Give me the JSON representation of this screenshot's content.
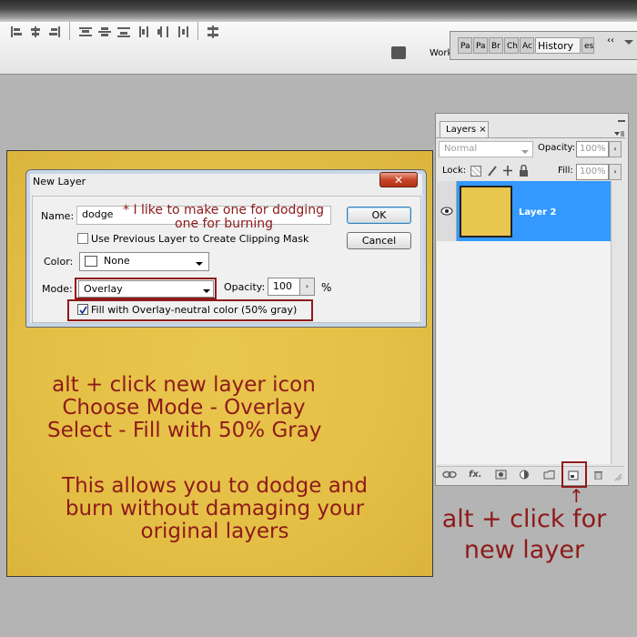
{
  "toolbar": {
    "workspace_label": "Work",
    "panel_tabs": [
      "Pa",
      "Pa",
      "Br",
      "Ch",
      "Ac",
      "History",
      "es"
    ]
  },
  "dialog": {
    "title": "New Layer",
    "name_label": "Name:",
    "name_value": "dodge",
    "use_previous_label": "Use Previous Layer to Create Clipping Mask",
    "use_previous_checked": false,
    "color_label": "Color:",
    "color_value": "None",
    "mode_label": "Mode:",
    "mode_value": "Overlay",
    "opacity_label": "Opacity:",
    "opacity_value": "100",
    "opacity_unit": "%",
    "fill_label": "Fill with Overlay-neutral color (50% gray)",
    "fill_checked": true,
    "ok_label": "OK",
    "cancel_label": "Cancel",
    "close_glyph": "✕"
  },
  "layers_panel": {
    "tab_label": "Layers",
    "tab_close": "×",
    "blend_mode": "Normal",
    "opacity_label": "Opacity:",
    "opacity_value": "100%",
    "lock_label": "Lock:",
    "fill_label": "Fill:",
    "fill_value": "100%",
    "layer_name": "Layer 2",
    "layer_fill_color": "#e9c64e",
    "selected_row_color": "#3399ff"
  },
  "annotations": {
    "name_note_line1": "* I like to make one for dodging",
    "name_note_line2": "one for burning",
    "steps": [
      "alt + click new layer icon",
      "Choose Mode - Overlay",
      "Select - Fill with 50% Gray"
    ],
    "explanation": [
      "This allows you to dodge and",
      "burn without damaging your",
      "original layers"
    ],
    "arrow_glyph": "↑",
    "footer_note": [
      "alt + click for",
      "new layer"
    ],
    "highlight_color": "#8e1a1a"
  }
}
